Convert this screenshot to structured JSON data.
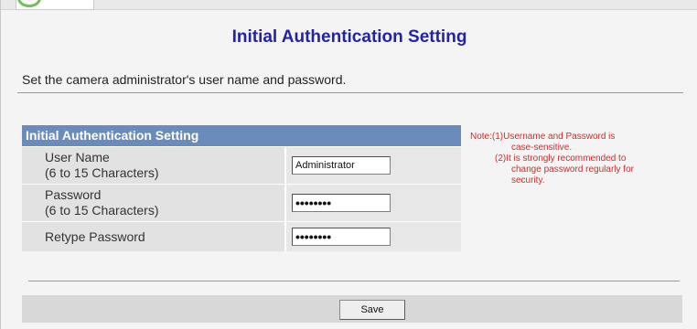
{
  "page": {
    "title": "Initial Authentication Setting",
    "intro": "Set the camera administrator's user name and password."
  },
  "form": {
    "header": "Initial Authentication Setting",
    "rows": [
      {
        "label_line1": "User Name",
        "label_line2": "(6 to 15 Characters)",
        "value": "Administrator",
        "type": "text"
      },
      {
        "label_line1": "Password",
        "label_line2": "(6 to 15 Characters)",
        "value": "passw0rd",
        "type": "password"
      },
      {
        "label_line1": "Retype Password",
        "label_line2": "",
        "value": "passw0rd",
        "type": "password"
      }
    ]
  },
  "note": {
    "line1": "Note:(1)Username and Password is",
    "line2": "case-sensitive.",
    "line3": "(2)It is strongly recommended to",
    "line4": "change password regularly for",
    "line5": "security."
  },
  "actions": {
    "save_label": "Save"
  },
  "colors": {
    "title": "#2323a8",
    "header_bg": "#6b8bbb",
    "note": "#cf2b2b"
  }
}
